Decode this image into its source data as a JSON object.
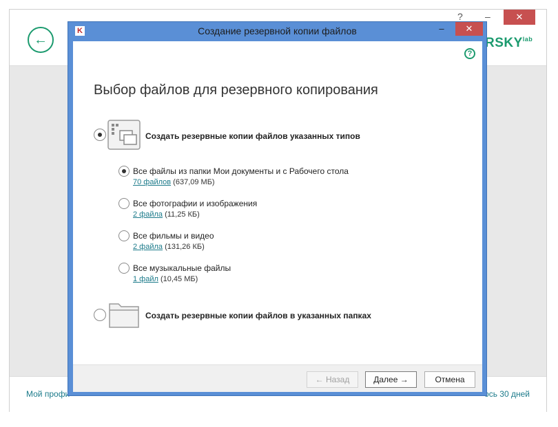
{
  "background_window": {
    "back_icon": "arrow-left-icon",
    "help_label": "?",
    "minimize_label": "–",
    "close_label": "✕",
    "logo_text": "RSKY",
    "logo_suffix": "lab",
    "footer_left": "Мой профи",
    "footer_right": "ось 30 дней"
  },
  "dialog": {
    "title": "Создание резервной копии файлов",
    "app_icon": "kaspersky-k-icon",
    "app_icon_glyph": "K",
    "minimize_label": "–",
    "maximize_label": "☐",
    "close_label": "✕",
    "help_icon_label": "?",
    "heading": "Выбор файлов для резервного копирования",
    "option_types": {
      "label": "Создать резервные копии файлов указанных типов",
      "selected": true,
      "icon": "file-types-icon"
    },
    "sub_options": [
      {
        "label": "Все файлы из папки Мои документы и с Рабочего стола",
        "link": "70 файлов",
        "size": "(637,09 МБ)",
        "selected": true
      },
      {
        "label": "Все фотографии и изображения",
        "link": "2 файла",
        "size": "(11,25 КБ)",
        "selected": false
      },
      {
        "label": "Все фильмы и видео",
        "link": "2 файла",
        "size": "(131,26 КБ)",
        "selected": false
      },
      {
        "label": "Все музыкальные файлы",
        "link": "1 файл",
        "size": "(10,45 МБ)",
        "selected": false
      }
    ],
    "option_folders": {
      "label": "Создать резервные копии файлов в указанных папках",
      "selected": false,
      "icon": "folder-icon"
    },
    "buttons": {
      "back": "← Назад",
      "next": "Далее →",
      "cancel": "Отмена"
    }
  },
  "colors": {
    "accent": "#1b9a6e",
    "dialog_frame": "#5a8fd6",
    "close_red": "#c75050",
    "link": "#1b7a8a"
  }
}
